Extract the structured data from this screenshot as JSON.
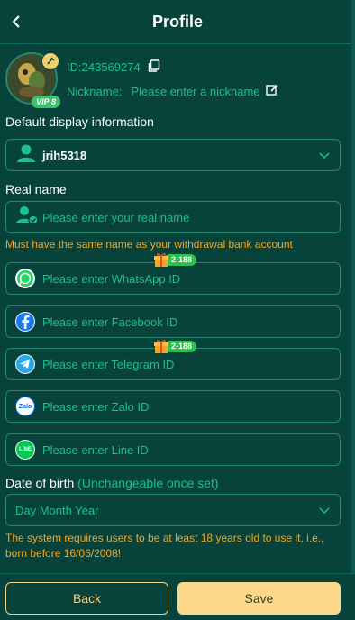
{
  "header": {
    "title": "Profile"
  },
  "profile": {
    "id_text": "ID:243569274",
    "vip_badge": "VIP 8",
    "nickname_label": "Nickname:",
    "nickname_placeholder": "Please enter a nickname"
  },
  "default_display": {
    "label": "Default display information",
    "value": "jrih5318"
  },
  "real_name": {
    "label": "Real name",
    "placeholder": "Please enter your real name",
    "warning": "Must have the same name as your withdrawal bank account"
  },
  "contacts": [
    {
      "icon": "whatsapp-icon",
      "placeholder": "Please enter WhatsApp ID",
      "bonus": "2-188"
    },
    {
      "icon": "facebook-icon",
      "placeholder": "Please enter Facebook ID"
    },
    {
      "icon": "telegram-icon",
      "placeholder": "Please enter Telegram ID",
      "bonus": "2-188"
    },
    {
      "icon": "zalo-icon",
      "placeholder": "Please enter Zalo ID",
      "icon_text": "Zalo"
    },
    {
      "icon": "line-icon",
      "placeholder": "Please enter Line ID",
      "icon_text": "LINE"
    }
  ],
  "dob": {
    "label": "Date of birth",
    "hint": "(Unchangeable once set)",
    "placeholder": "Day Month Year",
    "warning": "The system requires users to be at least 18 years old to use it, i.e., born before 16/06/2008!"
  },
  "footer": {
    "back_label": "Back",
    "save_label": "Save"
  },
  "colors": {
    "background": "#07433a",
    "accent_text": "#1cbf8f",
    "border": "#1f8a6c",
    "warning": "#f5a623",
    "save_button": "#fcd98a",
    "bonus_tag": "#2ec04f"
  }
}
